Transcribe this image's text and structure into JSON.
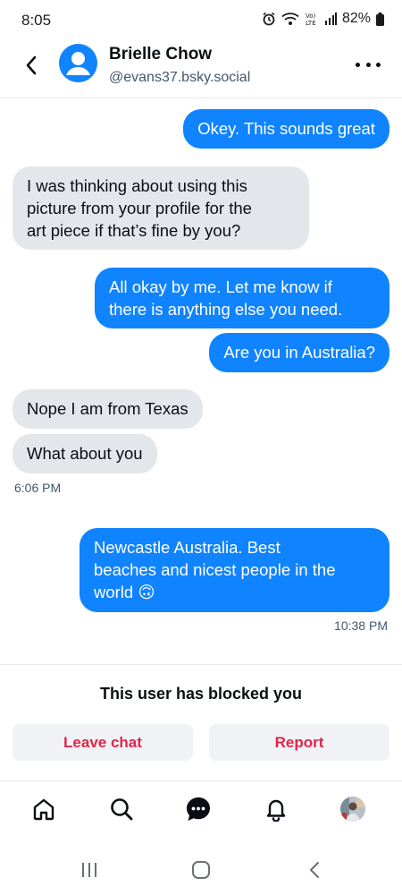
{
  "status_bar": {
    "time": "8:05",
    "battery": "82%",
    "icons": [
      "alarm-icon",
      "wifi-icon",
      "volte-icon",
      "signal-icon",
      "battery-icon"
    ]
  },
  "header": {
    "name": "Brielle Chow",
    "handle": "@evans37.bsky.social"
  },
  "messages": [
    {
      "dir": "out",
      "text": "Okey. This sounds great"
    },
    {
      "dir": "in",
      "lines": [
        "I was thinking about using this",
        "picture from your profile for the",
        "art piece if that’s fine by you?"
      ]
    },
    {
      "dir": "out",
      "lines": [
        "All okay by me. Let me know if",
        "there is anything else you need."
      ]
    },
    {
      "dir": "out",
      "text": "Are you in Australia?"
    },
    {
      "dir": "in",
      "text": "Nope I am from Texas"
    },
    {
      "dir": "in",
      "text": "What about you"
    },
    {
      "dir": "out",
      "lines": [
        "Newcastle Australia.  Best",
        "beaches and nicest people in the",
        "world 🙃"
      ]
    }
  ],
  "timestamps": {
    "incoming_group": "6:06 PM",
    "outgoing_last": "10:38 PM"
  },
  "blocked": {
    "message": "This user has blocked you",
    "leave_label": "Leave chat",
    "report_label": "Report"
  },
  "bottom_nav": [
    "home-icon",
    "search-icon",
    "chat-icon",
    "bell-icon",
    "profile-avatar"
  ],
  "colors": {
    "accent": "#1083fe",
    "incoming_bubble": "#e3e7eb",
    "danger": "#e0254a"
  }
}
